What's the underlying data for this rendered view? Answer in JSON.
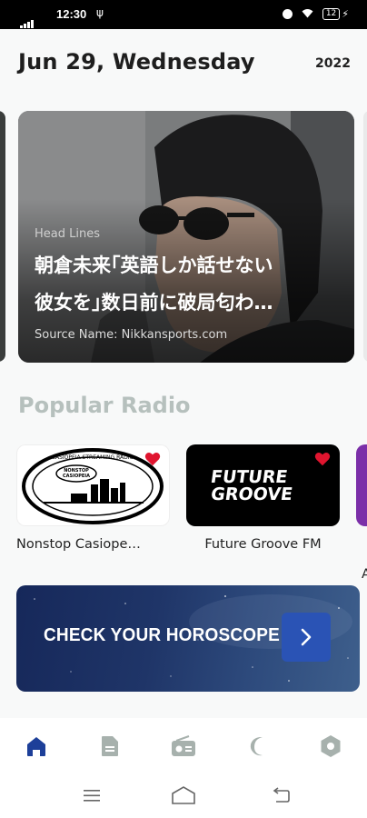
{
  "status_bar": {
    "time": "12:30",
    "battery": "12"
  },
  "header": {
    "date": "Jun 29, Wednesday",
    "year": "2022"
  },
  "headline": {
    "label": "Head Lines",
    "title": "朝倉未来｢英語しか話せない\n彼女を｣数日前に破局匂わ…",
    "source": "Source Name: Nikkansports.com"
  },
  "popular_radio": {
    "title": "Popular Radio",
    "stations": [
      {
        "name": "Nonstop Casiope…",
        "favorite": true
      },
      {
        "name": "Future Groove FM",
        "favorite": true
      },
      {
        "name": "A"
      }
    ]
  },
  "logos": {
    "casiopeia_top": "CASIOPEIA STREAMING RADIO",
    "casiopeia_badge": "NONSTOP\nCASIOPEIA",
    "future_1": "FUTURE",
    "future_2": "GROOVE"
  },
  "banner": {
    "title": "CHECK YOUR HOROSCOPE"
  },
  "bottom_nav": {
    "items": [
      {
        "icon": "home-icon",
        "active": true
      },
      {
        "icon": "document-icon",
        "active": false
      },
      {
        "icon": "radio-icon",
        "active": false
      },
      {
        "icon": "moon-icon",
        "active": false
      },
      {
        "icon": "settings-hexagon-icon",
        "active": false
      }
    ]
  },
  "colors": {
    "accent": "#1d3f99",
    "inactive_icon": "#a7b1ad",
    "heart": "#e0152f",
    "section_title": "#b6c0bd"
  }
}
